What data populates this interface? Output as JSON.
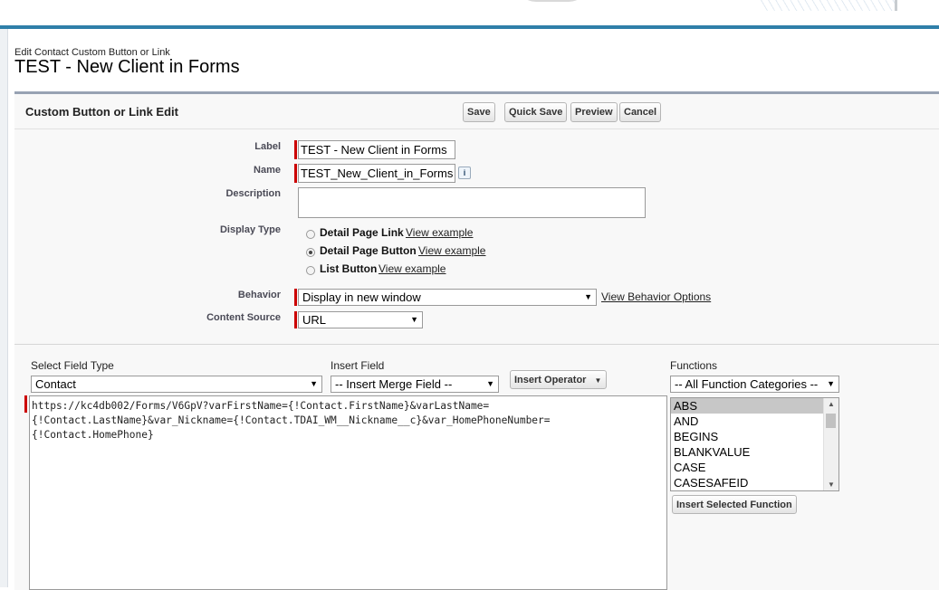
{
  "breadcrumb": "Edit Contact Custom Button or Link",
  "page_title": "TEST - New Client in Forms",
  "panel": {
    "title": "Custom Button or Link Edit",
    "buttons": {
      "save": "Save",
      "quick_save": "Quick Save",
      "preview": "Preview",
      "cancel": "Cancel"
    }
  },
  "form": {
    "label": {
      "caption": "Label",
      "value": "TEST - New Client in Forms"
    },
    "name": {
      "caption": "Name",
      "value": "TEST_New_Client_in_Forms"
    },
    "description": {
      "caption": "Description",
      "value": ""
    },
    "display_type": {
      "caption": "Display Type",
      "options": [
        {
          "label": "Detail Page Link",
          "link": "View example",
          "selected": false
        },
        {
          "label": "Detail Page Button",
          "link": "View example",
          "selected": true
        },
        {
          "label": "List Button",
          "link": "View example",
          "selected": false
        }
      ]
    },
    "behavior": {
      "caption": "Behavior",
      "value": "Display in new window",
      "link": "View Behavior Options"
    },
    "content_source": {
      "caption": "Content Source",
      "value": "URL"
    }
  },
  "editor": {
    "select_field_type": {
      "caption": "Select Field Type",
      "value": "Contact"
    },
    "insert_field": {
      "caption": "Insert Field",
      "value": "-- Insert Merge Field --"
    },
    "insert_operator": "Insert Operator",
    "functions": {
      "caption": "Functions",
      "category": "-- All Function Categories --",
      "items": [
        "ABS",
        "AND",
        "BEGINS",
        "BLANKVALUE",
        "CASE",
        "CASESAFEID"
      ],
      "selected": "ABS",
      "insert_button": "Insert Selected Function"
    },
    "formula_lines": [
      "https://kc4db002/Forms/V6GpV?varFirstName={!Contact.FirstName}&varLastName=",
      "{!Contact.LastName}&var_Nickname={!Contact.TDAI_WM__Nickname__c}&var_HomePhoneNumber=",
      "{!Contact.HomePhone}"
    ]
  },
  "colors": {
    "banner": "#2e84b3",
    "required": "#cc0000",
    "panel_border": "#97a2b3"
  }
}
